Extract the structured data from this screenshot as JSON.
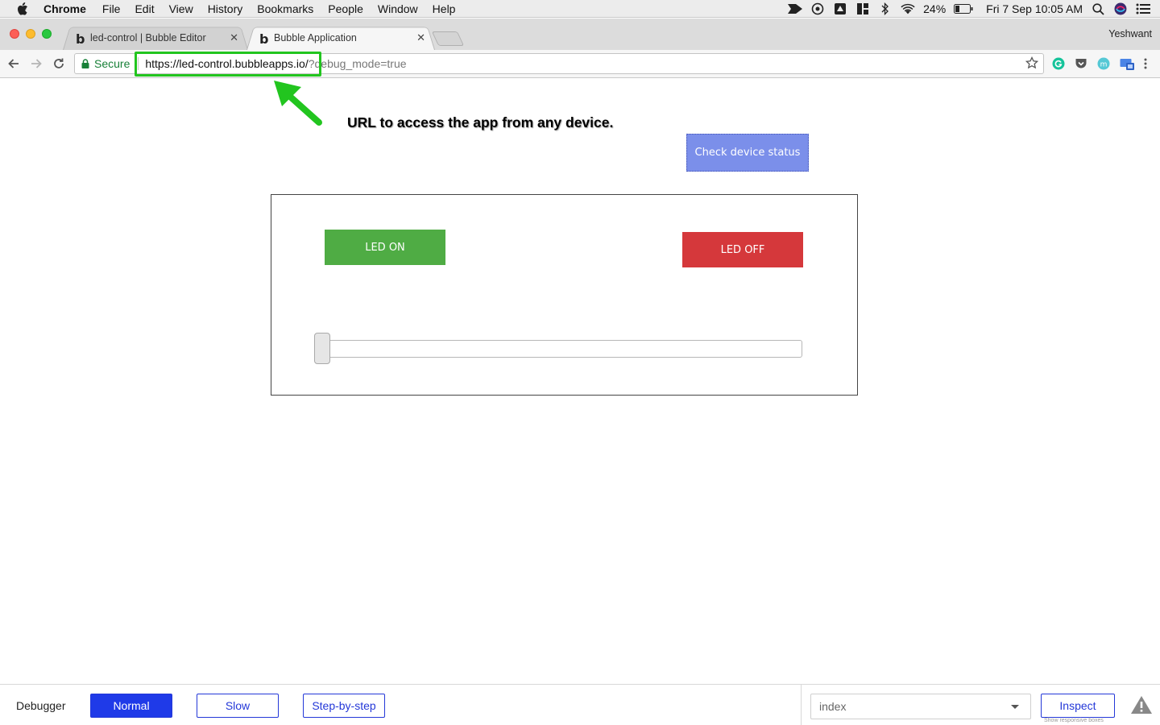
{
  "menubar": {
    "app": "Chrome",
    "items": [
      "File",
      "Edit",
      "View",
      "History",
      "Bookmarks",
      "People",
      "Window",
      "Help"
    ],
    "battery": "24%",
    "datetime": "Fri 7 Sep  10:05 AM"
  },
  "tabs": [
    {
      "favicon": "b",
      "title": "led-control | Bubble Editor",
      "close": "✕"
    },
    {
      "favicon": "b",
      "title": "Bubble Application",
      "close": "✕"
    }
  ],
  "profile": "Yeshwant",
  "toolbar": {
    "secure_label": "Secure",
    "url_main": "https://led-control.bubbleapps.io/",
    "url_rest": "?debug_mode=true"
  },
  "annotation": {
    "text": "URL to access the app from any device.",
    "highlight_color": "#22c51f"
  },
  "page": {
    "check_status_label": "Check device status",
    "led_on_label": "LED ON",
    "led_off_label": "LED OFF",
    "slider_value": 0
  },
  "debugger": {
    "label": "Debugger",
    "normal_label": "Normal",
    "slow_label": "Slow",
    "step_label": "Step-by-step",
    "page_select": "index",
    "inspect_label": "Inspect",
    "inspect_caption": "Show responsive boxes"
  },
  "colors": {
    "led_on": "#4fac44",
    "led_off": "#d5383b",
    "check_status": "#7b8fea",
    "debugger_accent": "#1f3ae8"
  }
}
